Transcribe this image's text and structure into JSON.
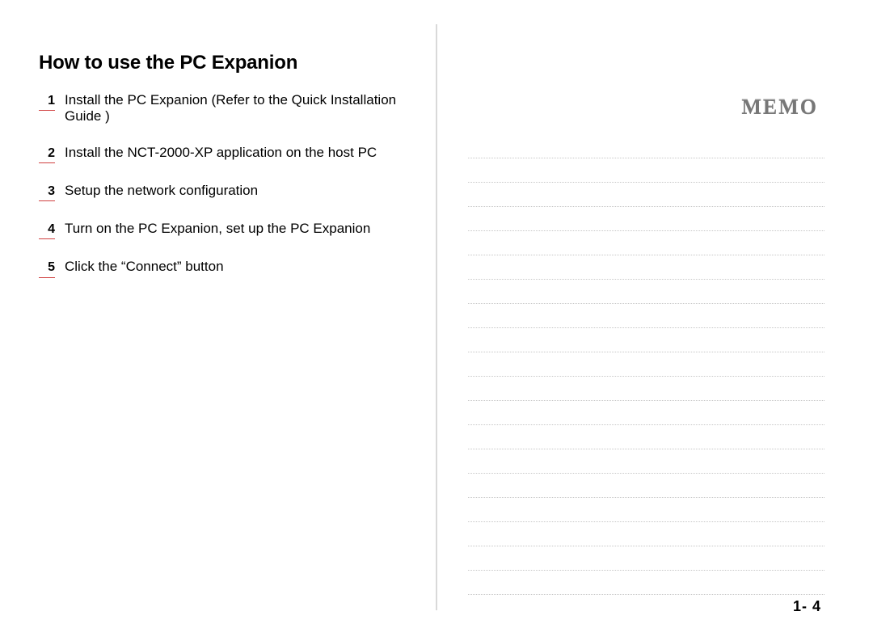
{
  "left": {
    "title": "How to use the PC Expanion",
    "steps": [
      {
        "n": "1",
        "text": "Install the PC Expanion (Refer to the Quick Installation Guide )"
      },
      {
        "n": "2",
        "text": "Install the NCT-2000-XP application on the host PC"
      },
      {
        "n": "3",
        "text": " Setup the network configuration"
      },
      {
        "n": "4",
        "text": "Turn on the PC Expanion, set up the PC Expanion"
      },
      {
        "n": "5",
        "text": "Click the “Connect”  button"
      }
    ]
  },
  "right": {
    "memo_label": "MEMO",
    "line_count": 19
  },
  "page_number": "1- 4"
}
